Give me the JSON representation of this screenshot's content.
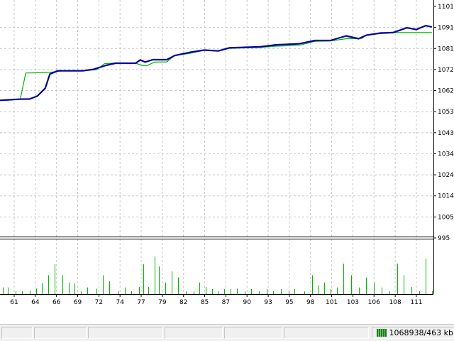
{
  "chart_data": [
    {
      "type": "line",
      "y_ticks": [
        "1101",
        "1091",
        "1081",
        "1072",
        "1062",
        "1053",
        "1043",
        "1034",
        "1024",
        "1014",
        "1005",
        "995"
      ],
      "ylim": [
        995,
        1101
      ],
      "grid": true,
      "series": [
        {
          "color": "#00b400",
          "points": [
            [
              59.6,
              1058
            ],
            [
              60.6,
              1058
            ],
            [
              61.6,
              1058.5
            ],
            [
              62.2,
              1058.6
            ],
            [
              62.9,
              1070.5
            ],
            [
              64.0,
              1070.6
            ],
            [
              66.0,
              1070.8
            ],
            [
              67.6,
              1071.5
            ],
            [
              70.0,
              1071.5
            ],
            [
              72.0,
              1072
            ],
            [
              73.0,
              1074.8
            ],
            [
              74.0,
              1075
            ],
            [
              77.0,
              1075
            ],
            [
              77.8,
              1074
            ],
            [
              78.4,
              1073.8
            ],
            [
              79.4,
              1075.5
            ],
            [
              81.0,
              1075.6
            ],
            [
              82.0,
              1078.5
            ],
            [
              84.0,
              1079.5
            ],
            [
              85.8,
              1081
            ],
            [
              87.6,
              1080.5
            ],
            [
              89.0,
              1081.8
            ],
            [
              93.0,
              1082.2
            ],
            [
              95.0,
              1082.8
            ],
            [
              98.0,
              1083.2
            ],
            [
              100.0,
              1085
            ],
            [
              102.0,
              1085.2
            ],
            [
              104.0,
              1086.2
            ],
            [
              106.0,
              1086.3
            ],
            [
              106.6,
              1088
            ],
            [
              108.4,
              1088.5
            ],
            [
              110.0,
              1089
            ],
            [
              115.0,
              1089
            ]
          ]
        },
        {
          "color": "#0000a0",
          "points": [
            [
              59.6,
              1058
            ],
            [
              60.6,
              1058.2
            ],
            [
              62.0,
              1058.5
            ],
            [
              63.4,
              1058.6
            ],
            [
              64.4,
              1060
            ],
            [
              65.4,
              1063.5
            ],
            [
              66.0,
              1070
            ],
            [
              67.0,
              1071.5
            ],
            [
              68.6,
              1071.5
            ],
            [
              70.2,
              1071.5
            ],
            [
              71.6,
              1072.2
            ],
            [
              73.2,
              1074
            ],
            [
              74.4,
              1075
            ],
            [
              77.0,
              1075
            ],
            [
              77.6,
              1076.5
            ],
            [
              78.2,
              1075.5
            ],
            [
              79.2,
              1076.6
            ],
            [
              81.0,
              1076.6
            ],
            [
              82.0,
              1078.5
            ],
            [
              84.0,
              1080
            ],
            [
              85.8,
              1081
            ],
            [
              87.6,
              1080.6
            ],
            [
              89.0,
              1082
            ],
            [
              93.0,
              1082.5
            ],
            [
              95.0,
              1083.4
            ],
            [
              98.0,
              1083.9
            ],
            [
              100.0,
              1085.4
            ],
            [
              102.0,
              1085.4
            ],
            [
              104.0,
              1087.5
            ],
            [
              105.6,
              1086.2
            ],
            [
              106.6,
              1087.8
            ],
            [
              108.4,
              1088.8
            ],
            [
              110.0,
              1089
            ],
            [
              111.8,
              1091.2
            ],
            [
              113.0,
              1090.4
            ],
            [
              114.2,
              1092.2
            ],
            [
              115.0,
              1091.6
            ]
          ]
        }
      ]
    },
    {
      "type": "bar",
      "x_ticks": [
        "61",
        "64",
        "66",
        "69",
        "72",
        "74",
        "77",
        "79",
        "82",
        "85",
        "87",
        "90",
        "93",
        "95",
        "98",
        "101",
        "103",
        "106",
        "108",
        "111"
      ],
      "xlim": [
        59.6,
        115.2
      ],
      "color": "#00b400",
      "bars": [
        [
          60.0,
          0.12
        ],
        [
          60.6,
          0.12
        ],
        [
          61.6,
          0.05
        ],
        [
          62.4,
          0.06
        ],
        [
          63.4,
          0.06
        ],
        [
          64.2,
          0.1
        ],
        [
          65.0,
          0.2
        ],
        [
          65.8,
          0.34
        ],
        [
          66.6,
          0.54
        ],
        [
          67.6,
          0.34
        ],
        [
          68.4,
          0.21
        ],
        [
          69.2,
          0.19
        ],
        [
          70.0,
          0.05
        ],
        [
          70.8,
          0.12
        ],
        [
          72.0,
          0.1
        ],
        [
          72.8,
          0.34
        ],
        [
          73.6,
          0.23
        ],
        [
          74.8,
          0.05
        ],
        [
          75.6,
          0.12
        ],
        [
          76.4,
          0.05
        ],
        [
          77.4,
          0.13
        ],
        [
          78.0,
          0.54
        ],
        [
          78.6,
          0.13
        ],
        [
          79.4,
          0.68
        ],
        [
          80.0,
          0.5
        ],
        [
          80.8,
          0.21
        ],
        [
          81.6,
          0.41
        ],
        [
          82.4,
          0.3
        ],
        [
          83.4,
          0.05
        ],
        [
          84.4,
          0.05
        ],
        [
          85.2,
          0.21
        ],
        [
          86.0,
          0.13
        ],
        [
          86.8,
          0.09
        ],
        [
          87.6,
          0.05
        ],
        [
          88.4,
          0.09
        ],
        [
          89.2,
          0.09
        ],
        [
          90.0,
          0.1
        ],
        [
          91.0,
          0.05
        ],
        [
          91.8,
          0.09
        ],
        [
          92.8,
          0.05
        ],
        [
          93.8,
          0.09
        ],
        [
          94.6,
          0.05
        ],
        [
          95.6,
          0.09
        ],
        [
          96.6,
          0.05
        ],
        [
          97.4,
          0.09
        ],
        [
          98.6,
          0.05
        ],
        [
          99.6,
          0.34
        ],
        [
          100.4,
          0.16
        ],
        [
          101.2,
          0.21
        ],
        [
          102.0,
          0.09
        ],
        [
          102.8,
          0.12
        ],
        [
          103.6,
          0.55
        ],
        [
          104.6,
          0.34
        ],
        [
          105.6,
          0.12
        ],
        [
          106.6,
          0.3
        ],
        [
          107.6,
          0.21
        ],
        [
          108.6,
          0.12
        ],
        [
          109.6,
          0.05
        ],
        [
          110.6,
          0.55
        ],
        [
          111.4,
          0.34
        ],
        [
          112.4,
          0.13
        ],
        [
          113.4,
          0.05
        ],
        [
          114.2,
          0.64
        ],
        [
          115.0,
          0.05
        ]
      ]
    }
  ],
  "status_bar": {
    "traffic_text": "1068938/463 kb",
    "traffic_icon": "connection-bars-icon"
  }
}
